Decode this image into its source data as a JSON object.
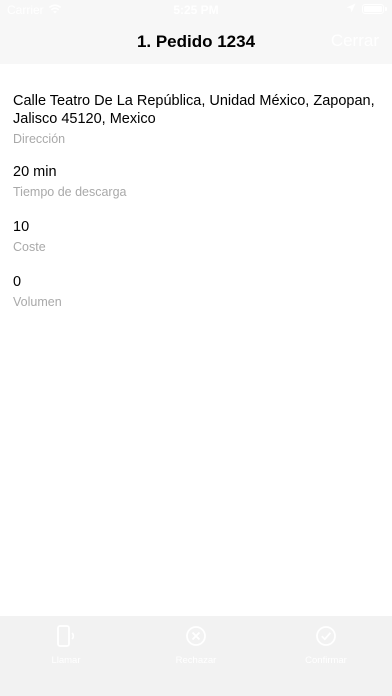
{
  "status_bar": {
    "carrier": "Carrier",
    "time": "5:25 PM"
  },
  "nav": {
    "title": "1. Pedido 1234",
    "close_label": "Cerrar"
  },
  "fields": [
    {
      "value": "Calle Teatro De La República, Unidad México, Zapopan, Jalisco 45120, Mexico",
      "label": "Dirección"
    },
    {
      "value": "20 min",
      "label": "Tiempo de descarga"
    },
    {
      "value": "10",
      "label": "Coste"
    },
    {
      "value": "0",
      "label": "Volumen"
    }
  ],
  "tab_bar": {
    "items": [
      {
        "label": "Llamar",
        "icon": "phone-icon"
      },
      {
        "label": "Rechazar",
        "icon": "x-circle-icon"
      },
      {
        "label": "Confirmar",
        "icon": "check-circle-icon"
      }
    ]
  },
  "colors": {
    "bar_background": "#f7f7f7",
    "tab_background": "#f2f2f2",
    "label_gray": "#a9a9a9"
  }
}
